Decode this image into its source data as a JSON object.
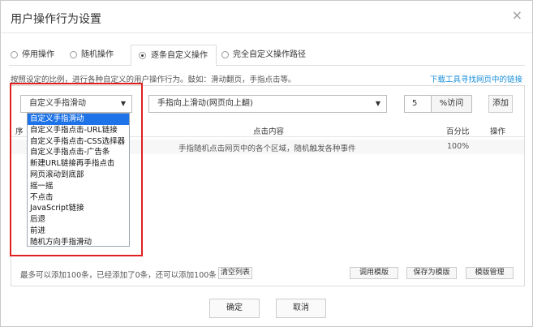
{
  "dialog": {
    "title": "用户操作行为设置"
  },
  "tabs": [
    {
      "label": "停用操作"
    },
    {
      "label": "随机操作"
    },
    {
      "label": "逐条自定义操作"
    },
    {
      "label": "完全自定义操作路径"
    }
  ],
  "description": "按照设定的比例，进行各种自定义的用户操作行为。鼓如：滑动翻页，手指点击等。",
  "download_link": "下载工具寻找网页中的链接",
  "controls": {
    "action_select": "自定义手指滑动",
    "direction_select": "手指向上滑动(网页向上翻)",
    "percent_value": "5",
    "percent_unit": "%访问",
    "add_label": "添加"
  },
  "dropdown_options": [
    "自定义手指滑动",
    "自定义手指点击-URL链接",
    "自定义手指点击-CSS选择器",
    "自定义手指点击-广告条",
    "新建URL链接再手指点击",
    "网页滚动到底部",
    "摇一摇",
    "不点击",
    "JavaScript链接",
    "后退",
    "前进",
    "随机方向手指滑动"
  ],
  "table": {
    "headers": [
      "序",
      "点击内容",
      "百分比",
      "操作"
    ],
    "rows": [
      {
        "content": "手指随机点击网页中的各个区域，随机触发各种事件",
        "percent": "100%"
      }
    ]
  },
  "footer": {
    "info": "最多可以添加100条，已经添加了0条，还可以添加100条",
    "clear_label": "清空列表",
    "use_template": "调用模版",
    "save_template": "保存为模版",
    "manage_template": "模版管理"
  },
  "buttons": {
    "ok": "确定",
    "cancel": "取消"
  }
}
